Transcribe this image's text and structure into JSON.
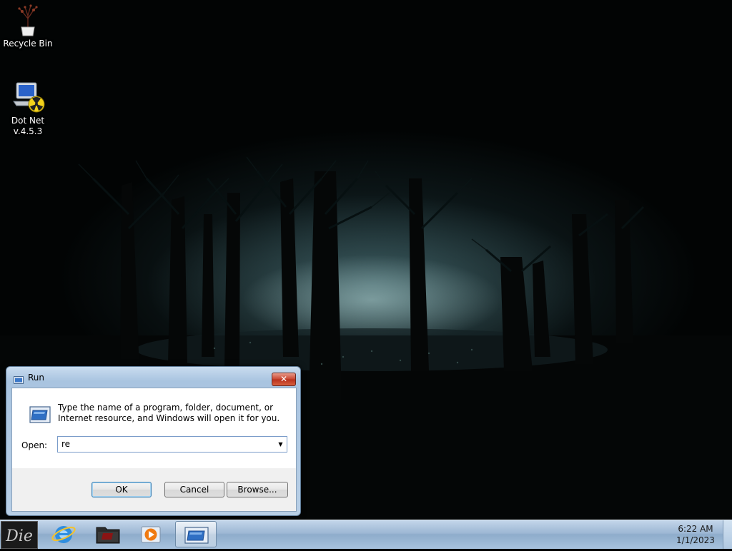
{
  "desktop": {
    "icons": [
      {
        "label": "Recycle Bin",
        "icon": "recycle-bin-icon"
      },
      {
        "label": "Dot Net\nv.4.5.3",
        "label_line1": "Dot Net",
        "label_line2": "v.4.5.3",
        "icon": "dotnet-installer-icon"
      }
    ]
  },
  "run_dialog": {
    "title": "Run",
    "close_glyph": "✕",
    "description": "Type the name of a program, folder, document, or Internet resource, and Windows will open it for you.",
    "open_label": "Open:",
    "open_value": "re",
    "dropdown_glyph": "▼",
    "ok_label": "OK",
    "cancel_label": "Cancel",
    "browse_label": "Browse..."
  },
  "taskbar": {
    "items": [
      {
        "name": "start",
        "icon": "start-orb-icon",
        "text": "Die"
      },
      {
        "name": "internet-explorer",
        "icon": "internet-explorer-icon"
      },
      {
        "name": "file-explorer",
        "icon": "folder-icon"
      },
      {
        "name": "media-player",
        "icon": "media-player-icon"
      },
      {
        "name": "run",
        "icon": "run-icon",
        "active": true
      }
    ],
    "clock": {
      "time": "6:22 AM",
      "date": "1/1/2023"
    }
  },
  "colors": {
    "taskbar": "#9db7d4",
    "dialog_frame": "#b8cfe6",
    "close_button": "#c8442e"
  }
}
